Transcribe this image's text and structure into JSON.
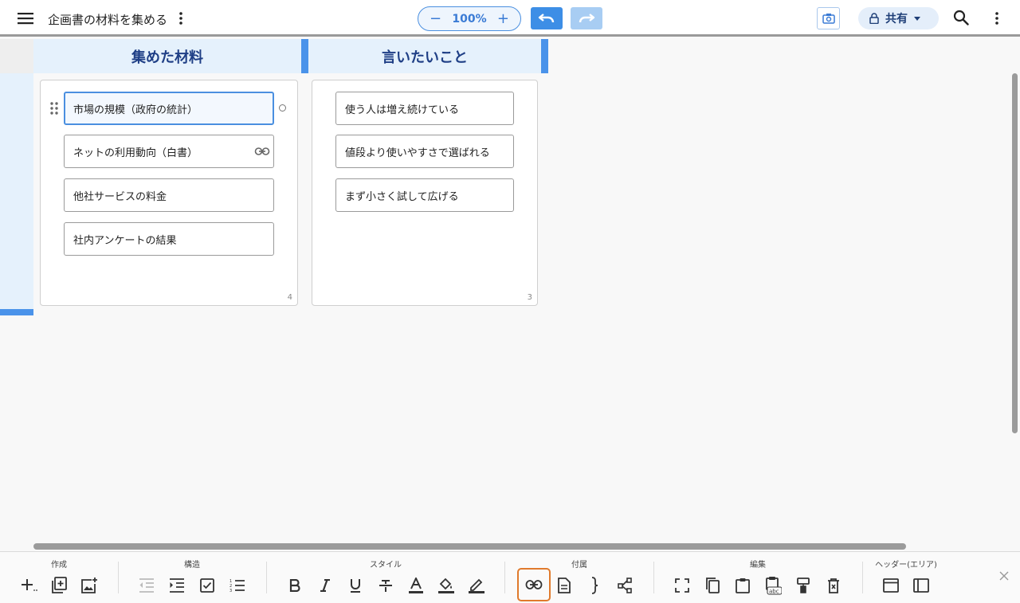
{
  "header": {
    "title": "企画書の材料を集める",
    "zoom": "100%",
    "zoom_out": "−",
    "zoom_in": "+",
    "share_label": "共有"
  },
  "lanes": [
    {
      "title": "集めた材料",
      "count": "4",
      "cards": [
        "市場の規模（政府の統計）",
        "ネットの利用動向（白書）",
        "他社サービスの料金",
        "社内アンケートの結果"
      ]
    },
    {
      "title": "言いたいこと",
      "count": "3",
      "cards": [
        "使う人は増え続けている",
        "値段より使いやすさで選ばれる",
        "まず小さく試して広げる"
      ]
    }
  ],
  "toolbar": {
    "groups": [
      "作成",
      "構造",
      "スタイル",
      "付属",
      "編集",
      "ヘッダー(エリア)"
    ]
  },
  "colors": {
    "accent": "#4a93ea",
    "header_bg": "#e5f1fc",
    "header_text": "#1f3f86",
    "active_tool_border": "#e07a2c"
  }
}
